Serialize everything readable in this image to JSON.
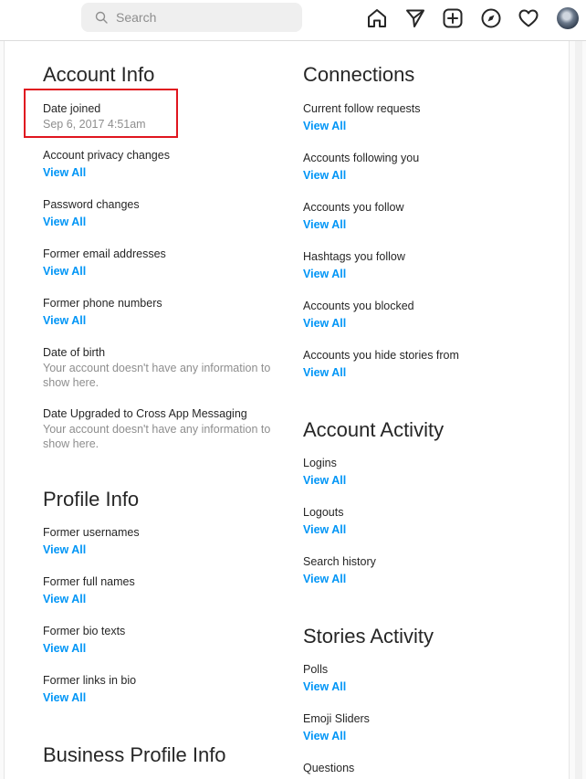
{
  "search": {
    "placeholder": "Search"
  },
  "nav": {
    "icons": [
      "home-icon",
      "direct-messages-icon",
      "new-post-icon",
      "explore-icon",
      "activity-heart-icon",
      "profile-avatar"
    ]
  },
  "left": {
    "account_info": {
      "title": "Account Info",
      "date_joined": {
        "label": "Date joined",
        "value": "Sep 6, 2017 4:51am"
      },
      "privacy_changes": {
        "label": "Account privacy changes",
        "link": "View All"
      },
      "password_changes": {
        "label": "Password changes",
        "link": "View All"
      },
      "former_emails": {
        "label": "Former email addresses",
        "link": "View All"
      },
      "former_phones": {
        "label": "Former phone numbers",
        "link": "View All"
      },
      "date_of_birth": {
        "label": "Date of birth",
        "line1": "Your account doesn't have any information to",
        "line2": "show here."
      },
      "cross_app": {
        "label": "Date Upgraded to Cross App Messaging",
        "line1": "Your account doesn't have any information to",
        "line2": "show here."
      }
    },
    "profile_info": {
      "title": "Profile Info",
      "usernames": {
        "label": "Former usernames",
        "link": "View All"
      },
      "full_names": {
        "label": "Former full names",
        "link": "View All"
      },
      "bio_texts": {
        "label": "Former bio texts",
        "link": "View All"
      },
      "links_in_bio": {
        "label": "Former links in bio",
        "link": "View All"
      }
    },
    "business_profile_info": {
      "title": "Business Profile Info"
    }
  },
  "right": {
    "connections": {
      "title": "Connections",
      "follow_requests": {
        "label": "Current follow requests",
        "link": "View All"
      },
      "following_you": {
        "label": "Accounts following you",
        "link": "View All"
      },
      "you_follow": {
        "label": "Accounts you follow",
        "link": "View All"
      },
      "hashtags": {
        "label": "Hashtags you follow",
        "link": "View All"
      },
      "blocked": {
        "label": "Accounts you blocked",
        "link": "View All"
      },
      "hide_stories": {
        "label": "Accounts you hide stories from",
        "link": "View All"
      }
    },
    "account_activity": {
      "title": "Account Activity",
      "logins": {
        "label": "Logins",
        "link": "View All"
      },
      "logouts": {
        "label": "Logouts",
        "link": "View All"
      },
      "search_history": {
        "label": "Search history",
        "link": "View All"
      }
    },
    "stories_activity": {
      "title": "Stories Activity",
      "polls": {
        "label": "Polls",
        "link": "View All"
      },
      "emoji_sliders": {
        "label": "Emoji Sliders",
        "link": "View All"
      },
      "questions": {
        "label": "Questions"
      }
    }
  },
  "colors": {
    "link": "#0095f6",
    "highlight_box": "#e0161f",
    "muted_text": "#8e8e8e"
  }
}
